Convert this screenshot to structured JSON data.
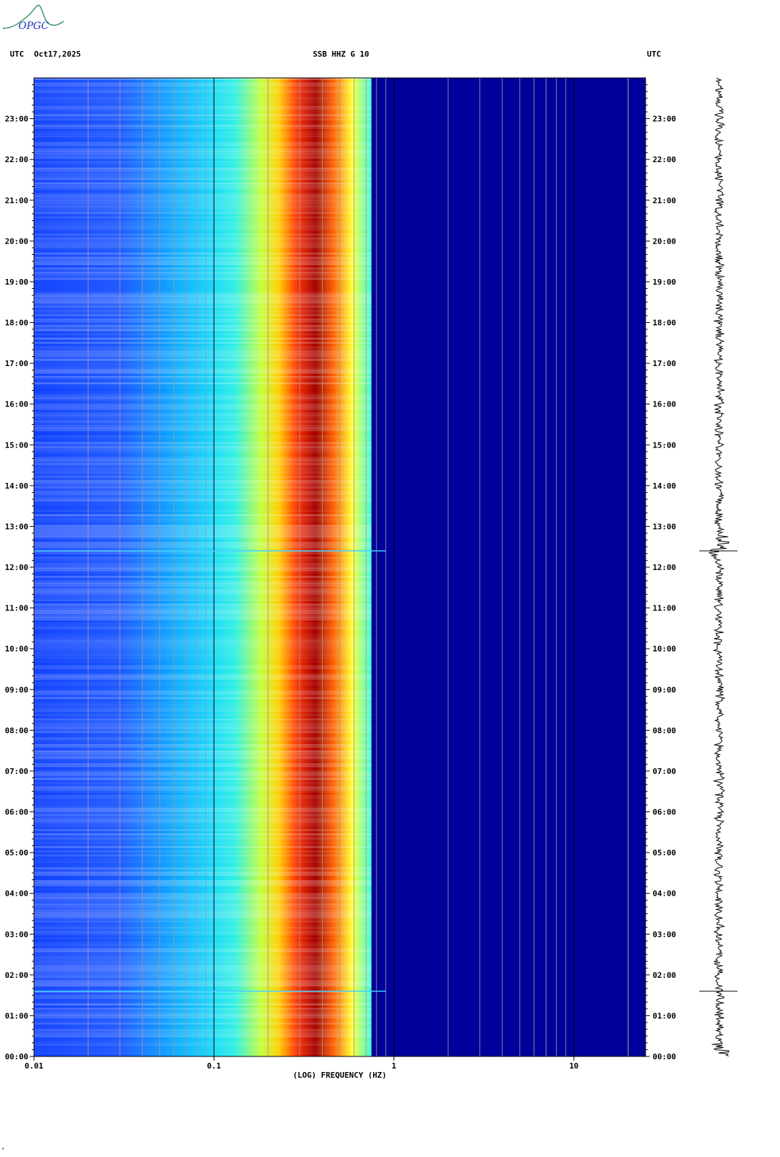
{
  "header": {
    "left_tz": "UTC",
    "date": "Oct17,2025",
    "station": "SSB HHZ G 10",
    "right_tz": "UTC"
  },
  "logo": {
    "text": "OPGC"
  },
  "footer_mark": "ᴹ",
  "chart_data": {
    "type": "heatmap",
    "title": "SSB HHZ G 10",
    "xlabel": "(LOG) FREQUENCY (HZ)",
    "ylabel": "",
    "x_scale": "log",
    "xlim": [
      0.01,
      25
    ],
    "ylim_hours": [
      0,
      24
    ],
    "x_tick_labels": [
      "0.01",
      "0.1",
      "1",
      "10"
    ],
    "x_tick_values": [
      0.01,
      0.1,
      1,
      10
    ],
    "y_tick_labels": [
      "00:00",
      "01:00",
      "02:00",
      "03:00",
      "04:00",
      "05:00",
      "06:00",
      "07:00",
      "08:00",
      "09:00",
      "10:00",
      "11:00",
      "12:00",
      "13:00",
      "14:00",
      "15:00",
      "16:00",
      "17:00",
      "18:00",
      "19:00",
      "20:00",
      "21:00",
      "22:00",
      "23:00"
    ],
    "y_tick_values": [
      0,
      1,
      2,
      3,
      4,
      5,
      6,
      7,
      8,
      9,
      10,
      11,
      12,
      13,
      14,
      15,
      16,
      17,
      18,
      19,
      20,
      21,
      22,
      23
    ],
    "colormap": [
      "#000080",
      "#0000ff",
      "#00bfff",
      "#00ffff",
      "#80ff80",
      "#ffff00",
      "#ff8000",
      "#ff0000",
      "#800000"
    ],
    "events_hours": [
      12.4,
      1.6
    ],
    "seismogram_color": "#000000"
  }
}
